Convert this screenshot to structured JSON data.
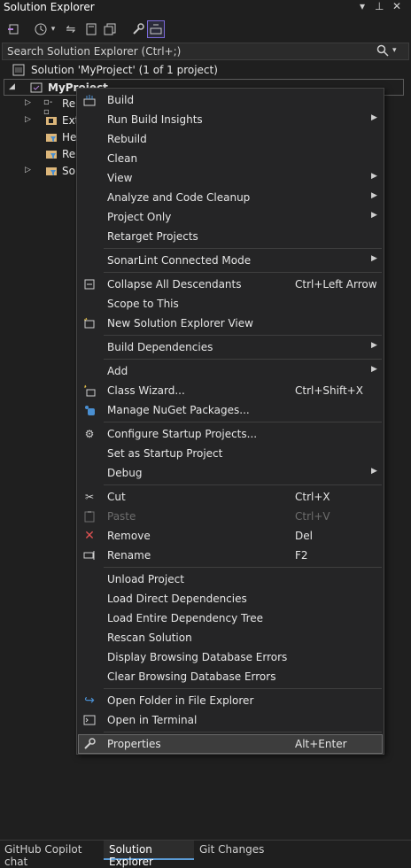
{
  "window": {
    "title": "Solution Explorer",
    "title_controls": [
      "▾",
      "⊥",
      "✕"
    ]
  },
  "toolbar": {
    "icons": [
      "vs-sync-icon",
      "history-icon",
      "dropdown-icon",
      "sync-arrows-icon",
      "pages-icon",
      "copy-icon",
      "wrench-icon",
      "preview-icon"
    ]
  },
  "search": {
    "placeholder": "Search Solution Explorer (Ctrl+;)"
  },
  "tree": {
    "solution": "Solution 'MyProject' (1 of 1 project)",
    "project": "MyProject",
    "children": [
      "Re",
      "Ext",
      "He",
      "Re",
      "So"
    ]
  },
  "menu": {
    "items": [
      {
        "label": "Build",
        "shortcut": "",
        "submenu": false,
        "icon": "build-icon"
      },
      {
        "label": "Run Build Insights",
        "shortcut": "",
        "submenu": true,
        "icon": ""
      },
      {
        "label": "Rebuild",
        "shortcut": "",
        "submenu": false,
        "icon": ""
      },
      {
        "label": "Clean",
        "shortcut": "",
        "submenu": false,
        "icon": ""
      },
      {
        "label": "View",
        "shortcut": "",
        "submenu": true,
        "icon": ""
      },
      {
        "label": "Analyze and Code Cleanup",
        "shortcut": "",
        "submenu": true,
        "icon": ""
      },
      {
        "label": "Project Only",
        "shortcut": "",
        "submenu": true,
        "icon": ""
      },
      {
        "label": "Retarget Projects",
        "shortcut": "",
        "submenu": false,
        "icon": ""
      },
      {
        "label": "SonarLint Connected Mode",
        "shortcut": "",
        "submenu": true,
        "icon": ""
      },
      {
        "label": "Collapse All Descendants",
        "shortcut": "Ctrl+Left Arrow",
        "submenu": false,
        "icon": "collapse-icon"
      },
      {
        "label": "Scope to This",
        "shortcut": "",
        "submenu": false,
        "icon": ""
      },
      {
        "label": "New Solution Explorer View",
        "shortcut": "",
        "submenu": false,
        "icon": "new-view-icon"
      },
      {
        "label": "Build Dependencies",
        "shortcut": "",
        "submenu": true,
        "icon": ""
      },
      {
        "label": "Add",
        "shortcut": "",
        "submenu": true,
        "icon": ""
      },
      {
        "label": "Class Wizard...",
        "shortcut": "Ctrl+Shift+X",
        "submenu": false,
        "icon": "class-wizard-icon"
      },
      {
        "label": "Manage NuGet Packages...",
        "shortcut": "",
        "submenu": false,
        "icon": "nuget-icon"
      },
      {
        "label": "Configure Startup Projects...",
        "shortcut": "",
        "submenu": false,
        "icon": "gear-icon"
      },
      {
        "label": "Set as Startup Project",
        "shortcut": "",
        "submenu": false,
        "icon": ""
      },
      {
        "label": "Debug",
        "shortcut": "",
        "submenu": true,
        "icon": ""
      },
      {
        "label": "Cut",
        "shortcut": "Ctrl+X",
        "submenu": false,
        "icon": "scissors-icon"
      },
      {
        "label": "Paste",
        "shortcut": "Ctrl+V",
        "submenu": false,
        "icon": "paste-icon",
        "disabled": true
      },
      {
        "label": "Remove",
        "shortcut": "Del",
        "submenu": false,
        "icon": "remove-icon"
      },
      {
        "label": "Rename",
        "shortcut": "F2",
        "submenu": false,
        "icon": "rename-icon"
      },
      {
        "label": "Unload Project",
        "shortcut": "",
        "submenu": false,
        "icon": ""
      },
      {
        "label": "Load Direct Dependencies",
        "shortcut": "",
        "submenu": false,
        "icon": ""
      },
      {
        "label": "Load Entire Dependency Tree",
        "shortcut": "",
        "submenu": false,
        "icon": ""
      },
      {
        "label": "Rescan Solution",
        "shortcut": "",
        "submenu": false,
        "icon": ""
      },
      {
        "label": "Display Browsing Database Errors",
        "shortcut": "",
        "submenu": false,
        "icon": ""
      },
      {
        "label": "Clear Browsing Database Errors",
        "shortcut": "",
        "submenu": false,
        "icon": ""
      },
      {
        "label": "Open Folder in File Explorer",
        "shortcut": "",
        "submenu": false,
        "icon": "open-folder-icon"
      },
      {
        "label": "Open in Terminal",
        "shortcut": "",
        "submenu": false,
        "icon": "terminal-icon"
      },
      {
        "label": "Properties",
        "shortcut": "Alt+Enter",
        "submenu": false,
        "icon": "wrench-icon",
        "highlighted": true
      }
    ]
  },
  "tabs": {
    "items": [
      {
        "label": "GitHub Copilot chat",
        "active": false
      },
      {
        "label": "Solution Explorer",
        "active": true
      },
      {
        "label": "Git Changes",
        "active": false
      }
    ]
  },
  "colors": {
    "background": "#1f1f1f",
    "menu_bg": "#252526",
    "accent": "#5b9bd5",
    "remove_red": "#e05252"
  }
}
